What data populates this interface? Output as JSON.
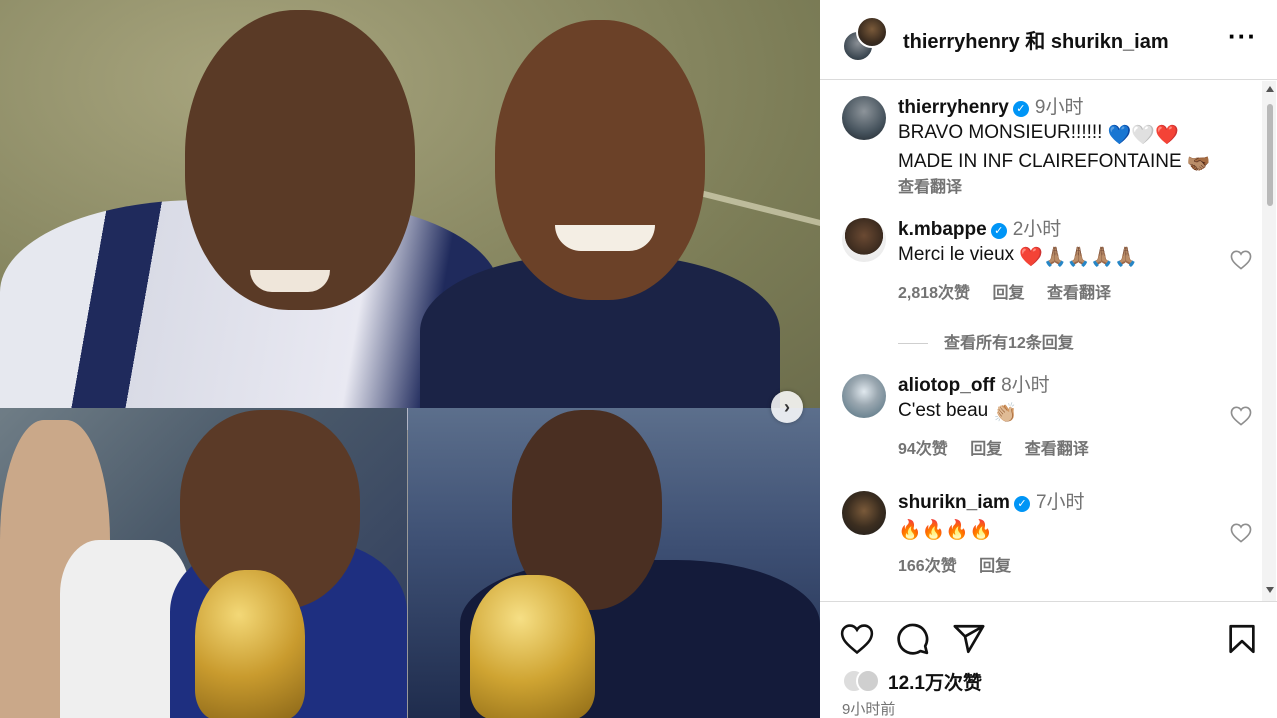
{
  "header": {
    "title": "thierryhenry 和 shurikn_iam",
    "more_icon": "more-horizontal-icon"
  },
  "comments": [
    {
      "username": "thierryhenry",
      "verified": true,
      "time": "9小时",
      "line1": "BRAVO MONSIEUR!!!!!! ",
      "line1_emoji": "💙🤍❤️",
      "line2": "MADE IN INF CLAIREFONTAINE ",
      "line2_emoji": "🫱🏽‍🫲🏾",
      "translate": "查看翻译"
    },
    {
      "username": "k.mbappe",
      "verified": true,
      "time": "2小时",
      "text": "Merci le vieux ",
      "emoji": "❤️🙏🏽🙏🏽🙏🏽🙏🏽",
      "likes": "2,818次赞",
      "reply": "回复",
      "translate": "查看翻译"
    },
    {
      "username": "aliotop_off",
      "verified": false,
      "time": "8小时",
      "text": "C'est beau ",
      "emoji": "👏🏼",
      "likes": "94次赞",
      "reply": "回复",
      "translate": "查看翻译"
    },
    {
      "username": "shurikn_iam",
      "verified": true,
      "time": "7小时",
      "text": "",
      "emoji": "🔥🔥🔥🔥",
      "likes": "166次赞",
      "reply": "回复"
    }
  ],
  "view_replies": "查看所有12条回复",
  "footer": {
    "likes": "12.1万次赞",
    "time": "9小时前"
  },
  "colors": {
    "verified": "#0095f6",
    "heart_red": "#ed4956",
    "muted": "#737373"
  }
}
